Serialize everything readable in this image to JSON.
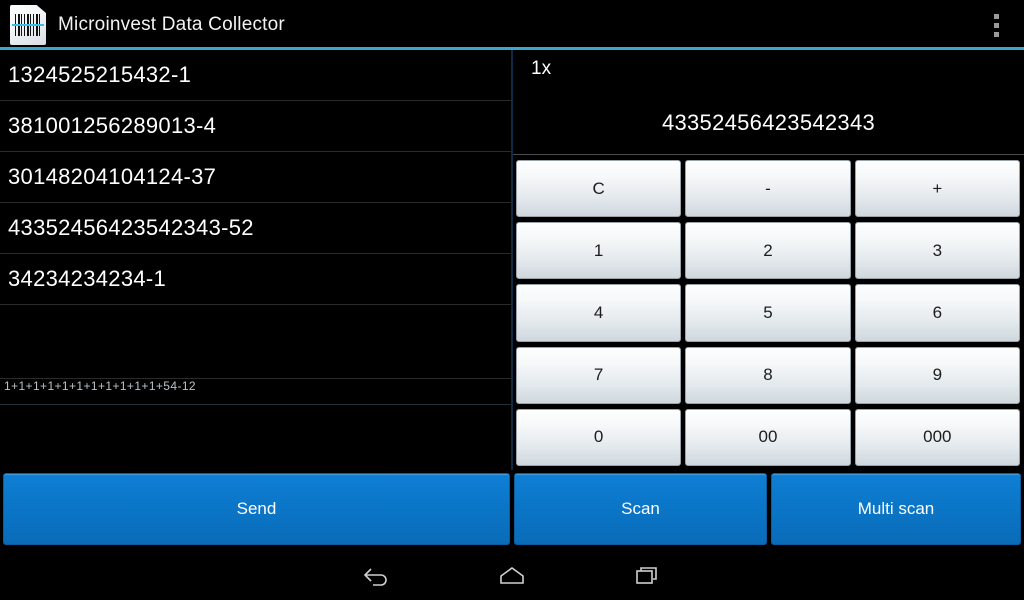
{
  "actionbar": {
    "icon_name": "barcode-document-icon",
    "title": "Microinvest Data Collector",
    "overflow_label": "⋮"
  },
  "left_pane": {
    "name": "scanned-items-list",
    "rows": [
      {
        "text": "1324525215432-1"
      },
      {
        "text": "381001256289013-4"
      },
      {
        "text": "30148204104124-37"
      },
      {
        "text": "43352456423542343-52"
      },
      {
        "text": "34234234234-1"
      },
      {
        "text": ""
      }
    ],
    "expression": "1+1+1+1+1+1+1+1+1+1+1+54-12"
  },
  "right_pane": {
    "display": {
      "multiplier": "1x",
      "value": "43352456423542343"
    },
    "keypad": {
      "keys": [
        {
          "label": "C",
          "name": "key-clear"
        },
        {
          "label": "-",
          "name": "key-minus"
        },
        {
          "label": "+",
          "name": "key-plus"
        },
        {
          "label": "1",
          "name": "key-1"
        },
        {
          "label": "2",
          "name": "key-2"
        },
        {
          "label": "3",
          "name": "key-3"
        },
        {
          "label": "4",
          "name": "key-4"
        },
        {
          "label": "5",
          "name": "key-5"
        },
        {
          "label": "6",
          "name": "key-6"
        },
        {
          "label": "7",
          "name": "key-7"
        },
        {
          "label": "8",
          "name": "key-8"
        },
        {
          "label": "9",
          "name": "key-9"
        },
        {
          "label": "0",
          "name": "key-0"
        },
        {
          "label": "00",
          "name": "key-00"
        },
        {
          "label": "000",
          "name": "key-000"
        }
      ]
    }
  },
  "actions": {
    "send": "Send",
    "scan": "Scan",
    "multi_scan": "Multi scan"
  },
  "navbar": {
    "back": "back-icon",
    "home": "home-icon",
    "recents": "recents-icon"
  },
  "colors": {
    "accent_rule": "#3aa8ce",
    "action_blue": "#0b76c8",
    "background": "#000000",
    "key_face": "#eef2f4"
  }
}
